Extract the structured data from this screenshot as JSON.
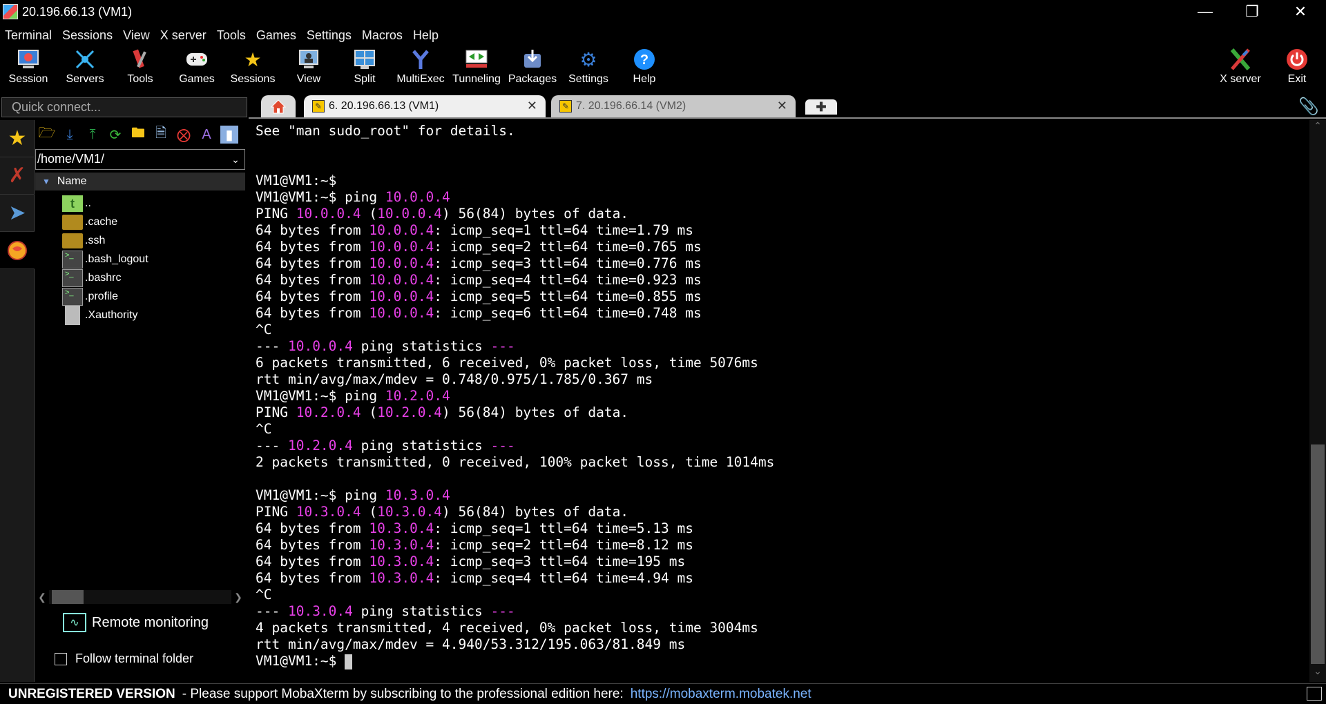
{
  "window": {
    "title": "20.196.66.13 (VM1)"
  },
  "menu": [
    "Terminal",
    "Sessions",
    "View",
    "X server",
    "Tools",
    "Games",
    "Settings",
    "Macros",
    "Help"
  ],
  "toolbar": {
    "session": "Session",
    "servers": "Servers",
    "tools": "Tools",
    "games": "Games",
    "sessions": "Sessions",
    "view": "View",
    "split": "Split",
    "multiexec": "MultiExec",
    "tunneling": "Tunneling",
    "packages": "Packages",
    "settings": "Settings",
    "help": "Help",
    "xserver": "X server",
    "exit": "Exit"
  },
  "quick_connect": {
    "placeholder": "Quick connect..."
  },
  "tabs": {
    "tab1": {
      "label": "6. 20.196.66.13 (VM1)",
      "active": true
    },
    "tab2": {
      "label": "7. 20.196.66.14 (VM2)",
      "active": false
    }
  },
  "sftp": {
    "path": "/home/VM1/",
    "column_name": "Name",
    "files": [
      "..",
      ".cache",
      ".ssh",
      ".bash_logout",
      ".bashrc",
      ".profile",
      ".Xauthority"
    ],
    "remote_monitoring": "Remote monitoring",
    "follow_folder": "Follow terminal folder",
    "follow_checked": false
  },
  "terminal": {
    "lines": [
      "See \"man sudo_root\" for details.",
      "",
      "",
      "VM1@VM1:~$",
      "VM1@VM1:~$ ping 10.0.0.4",
      "PING 10.0.0.4 (10.0.0.4) 56(84) bytes of data.",
      "64 bytes from 10.0.0.4: icmp_seq=1 ttl=64 time=1.79 ms",
      "64 bytes from 10.0.0.4: icmp_seq=2 ttl=64 time=0.765 ms",
      "64 bytes from 10.0.0.4: icmp_seq=3 ttl=64 time=0.776 ms",
      "64 bytes from 10.0.0.4: icmp_seq=4 ttl=64 time=0.923 ms",
      "64 bytes from 10.0.0.4: icmp_seq=5 ttl=64 time=0.855 ms",
      "64 bytes from 10.0.0.4: icmp_seq=6 ttl=64 time=0.748 ms",
      "^C",
      "--- 10.0.0.4 ping statistics ---",
      "6 packets transmitted, 6 received, 0% packet loss, time 5076ms",
      "rtt min/avg/max/mdev = 0.748/0.975/1.785/0.367 ms",
      "VM1@VM1:~$ ping 10.2.0.4",
      "PING 10.2.0.4 (10.2.0.4) 56(84) bytes of data.",
      "^C",
      "--- 10.2.0.4 ping statistics ---",
      "2 packets transmitted, 0 received, 100% packet loss, time 1014ms",
      "",
      "VM1@VM1:~$ ping 10.3.0.4",
      "PING 10.3.0.4 (10.3.0.4) 56(84) bytes of data.",
      "64 bytes from 10.3.0.4: icmp_seq=1 ttl=64 time=5.13 ms",
      "64 bytes from 10.3.0.4: icmp_seq=2 ttl=64 time=8.12 ms",
      "64 bytes from 10.3.0.4: icmp_seq=3 ttl=64 time=195 ms",
      "64 bytes from 10.3.0.4: icmp_seq=4 ttl=64 time=4.94 ms",
      "^C",
      "--- 10.3.0.4 ping statistics ---",
      "4 packets transmitted, 4 received, 0% packet loss, time 3004ms",
      "rtt min/avg/max/mdev = 4.940/53.312/195.063/81.849 ms",
      "VM1@VM1:~$ "
    ],
    "highlight_color": "#e740e7"
  },
  "status": {
    "unregistered": "UNREGISTERED VERSION",
    "message": "-  Please support MobaXterm by subscribing to the professional edition here:",
    "link": "https://mobaxterm.mobatek.net"
  }
}
